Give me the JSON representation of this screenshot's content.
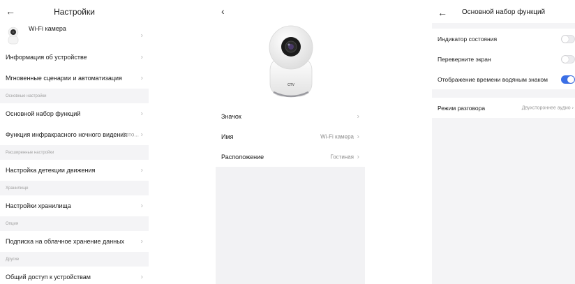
{
  "settings": {
    "back_icon": "arrow-left-icon",
    "title": "Настройки",
    "camera_name": "Wi-Fi камера",
    "items_top": [
      {
        "label": "Информация об устройстве"
      },
      {
        "label": "Мгновенные сценарии и автоматизация"
      }
    ],
    "section_basic": "Основные настройки",
    "items_basic": [
      {
        "label": "Основной набор функций"
      },
      {
        "label": "Функция инфракрасного ночного видения",
        "value": "Авто..."
      }
    ],
    "section_advanced": "Расширенные настройки",
    "items_advanced": [
      {
        "label": "Настройка детекции движения"
      }
    ],
    "section_storage": "Хранилище",
    "items_storage": [
      {
        "label": "Настройки хранилища"
      }
    ],
    "section_option": "Опция",
    "items_option": [
      {
        "label": "Подписка на облачное хранение данных"
      }
    ],
    "section_other": "Другие",
    "items_other": [
      {
        "label": "Общий доступ к устройствам"
      }
    ]
  },
  "device": {
    "back_icon": "chevron-left-icon",
    "brand": "CTV",
    "rows": [
      {
        "label": "Значок",
        "value": ""
      },
      {
        "label": "Имя",
        "value": "Wi-Fi камера"
      },
      {
        "label": "Расположение",
        "value": "Гостиная"
      }
    ]
  },
  "features": {
    "back_icon": "arrow-left-icon",
    "title": "Основной набор функций",
    "toggles": [
      {
        "label": "Индикатор состояния",
        "state": "off"
      },
      {
        "label": "Переверните экран",
        "state": "off"
      },
      {
        "label": "Отображение времени водяным знаком",
        "state": "on"
      }
    ],
    "talk_mode": {
      "label": "Режим разговора",
      "value": "Двухстороннее аудио"
    }
  },
  "colors": {
    "accent": "#3b6fe6",
    "background": "#f4f4f6"
  }
}
